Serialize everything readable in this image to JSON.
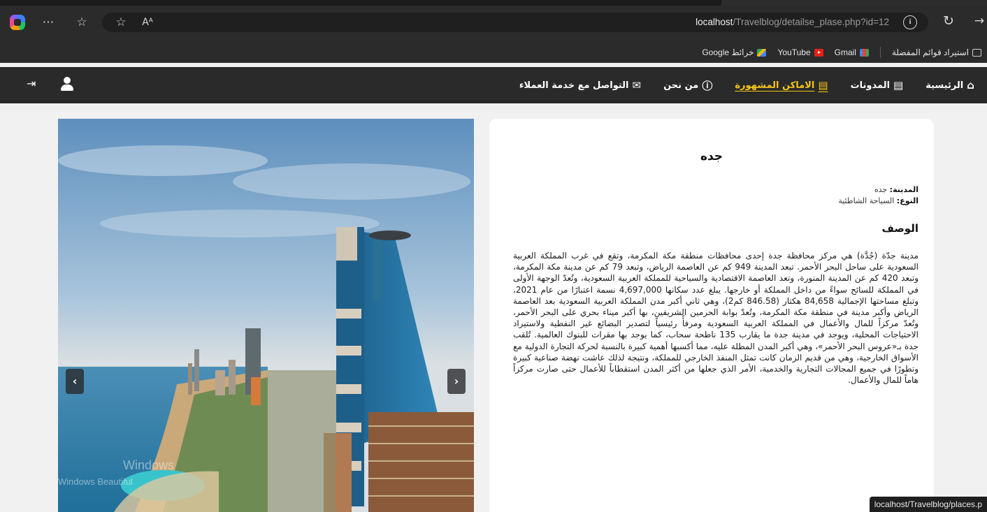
{
  "browser": {
    "url_host": "localhost",
    "url_path": "/Travelblog/detailse_plase.php?id=12",
    "aa_label": "Aᴬ",
    "bookmarks": [
      {
        "label": "استيراد قوائم المفضلة",
        "icon": "import-icon"
      },
      {
        "label": "Gmail",
        "icon": "gmail-icon"
      },
      {
        "label": "YouTube",
        "icon": "youtube-icon"
      },
      {
        "label": "خرائط Google",
        "icon": "maps-icon"
      }
    ],
    "status_url": "localhost/Travelblog/places.p"
  },
  "navbar": {
    "links": [
      {
        "label": "الرئيسية",
        "icon": "home-icon",
        "active": false
      },
      {
        "label": "المدونات",
        "icon": "blog-icon",
        "active": false
      },
      {
        "label": "الاماكن المشهورة",
        "icon": "places-icon",
        "active": true
      },
      {
        "label": "من نحن",
        "icon": "info-icon",
        "active": false
      },
      {
        "label": "التواصل مع خدمة العملاء",
        "icon": "envelope-icon",
        "active": false
      }
    ],
    "active_color": "#f5c518"
  },
  "place": {
    "title": "جده",
    "city_label": "المدينة:",
    "city_value": "جده",
    "type_label": "النوع:",
    "type_value": "السياحة الشاطئية",
    "desc_heading": "الوصف",
    "description": "مدينة جدّة (جُدَّة) هي مركز محافظة جدة إحدى محافظات منطقة مكة المكرمة، وتقع في غرب المملكة العربية السعودية على ساحل البحر الأحمر. تبعد المدينة 949 كم عن العاصمة الرياض، وتبعد 79 كم عن مدينة مكة المكرمة، وتبعد 420 كم عن المدينة المنورة، وتعد العاصمة الاقتصادية والسياحية للمملكة العربية السعودية، وتُعدّ الوجهة الأولى في المملكة للسائح سواءً من داخل المملكة أو خارجها. يبلغ عدد سكانها 4,697,000 نسمة اعتبارًا من عام 2021، وتبلغ مساحتها الإجمالية 84,658 هكتار (846.58 كم2)، وهي ثاني أكبر مدن المملكة العربية السعودية بعد العاصمة الرياض وأكبر مدينة في منطقة مكة المكرمة، وتُعدّ بوابة الحرمين الشريفين، بها أكبر ميناء بحري على البحر الأحمر، وتُعدّ مركزاً للمال والأعمال في المملكة العربية السعودية ومرفأً رئيسياً لتصدير البضائع غير النفطية ولاستيراد الاحتياجات المحلية، ويوجد في مدينة جدة ما يقارب 135 ناطحة سحاب، كما يوجد بها مقرات للبنوك العالمية. تُلقب جدة بـ«عروس البحر الأحمر»، وهي أكبر المدن المطلة عليه، مما أكسبها أهمية كبيرة بالنسبة لحركة التجارة الدولية مع الأسواق الخارجية، وهي من قديم الزمان كانت تمثل المنفذ الخارجي للمملكة، ونتيجة لذلك عاشت نهضة صناعية كبيرة وتطورًا في جميع المجالات التجارية والخدمية، الأمر الذي جعلها من أكثر المدن استقطاباً للأعمال حتى صارت مركزاً هاماً للمال والأعمال."
  },
  "carousel": {
    "prev_glyph": "‹",
    "next_glyph": "›",
    "watermark_line1": "Windows",
    "watermark_line2": "Windows Beautiful"
  }
}
